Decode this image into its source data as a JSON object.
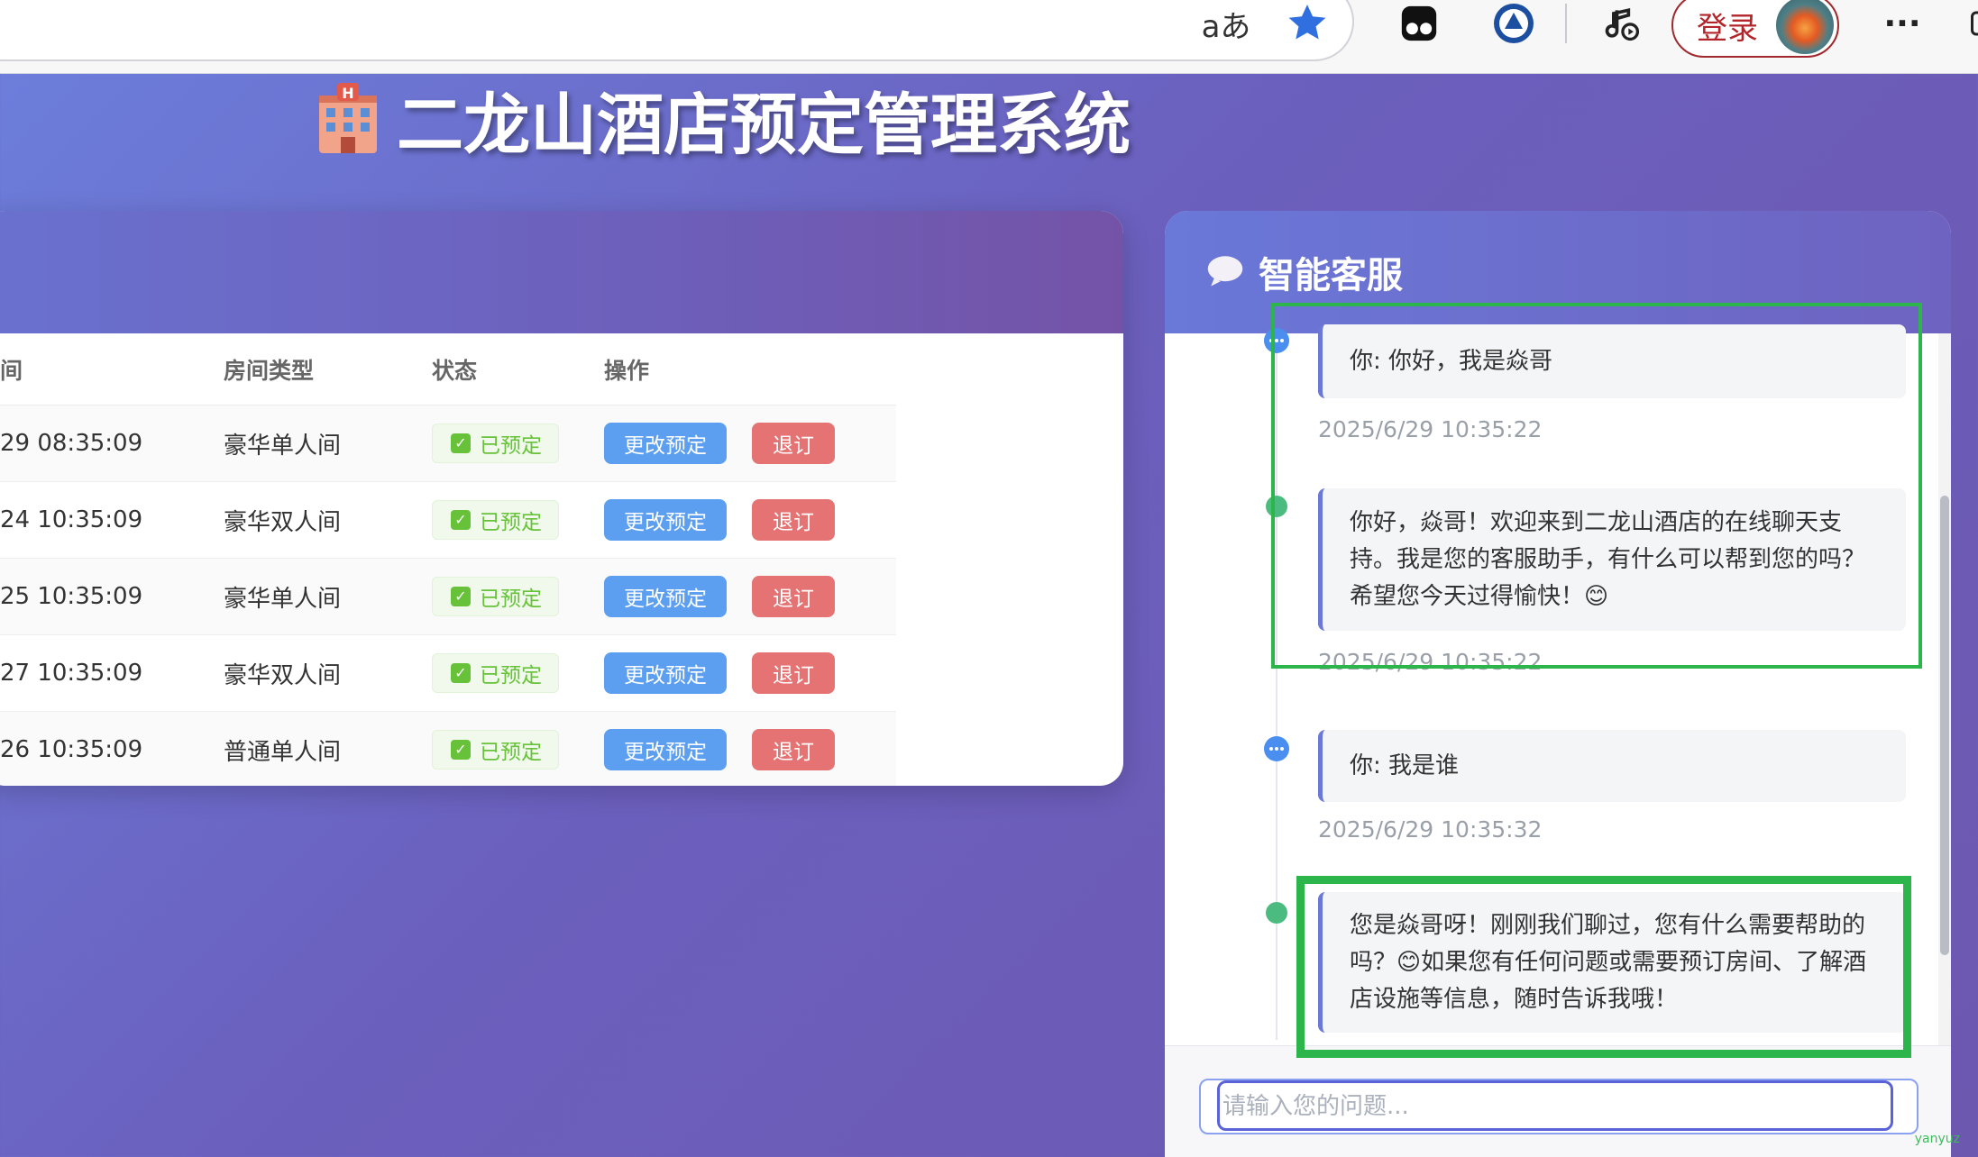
{
  "browser": {
    "login_label": "登录",
    "read_aloud_glyph": "aあ",
    "more_glyph": "···"
  },
  "page": {
    "title": "二龙山酒店预定管理系统"
  },
  "bookings": {
    "headers": {
      "time": "间",
      "room_type": "房间类型",
      "status": "状态",
      "actions": "操作"
    },
    "rows": [
      {
        "time": "29 08:35:09",
        "room_type": "豪华单人间",
        "status": "已预定",
        "modify": "更改预定",
        "cancel": "退订"
      },
      {
        "time": "24 10:35:09",
        "room_type": "豪华双人间",
        "status": "已预定",
        "modify": "更改预定",
        "cancel": "退订"
      },
      {
        "time": "25 10:35:09",
        "room_type": "豪华单人间",
        "status": "已预定",
        "modify": "更改预定",
        "cancel": "退订"
      },
      {
        "time": "27 10:35:09",
        "room_type": "豪华双人间",
        "status": "已预定",
        "modify": "更改预定",
        "cancel": "退订"
      },
      {
        "time": "26 10:35:09",
        "room_type": "普通单人间",
        "status": "已预定",
        "modify": "更改预定",
        "cancel": "退订"
      }
    ]
  },
  "chat": {
    "title": "智能客服",
    "messages": [
      {
        "role": "user",
        "text": "你: 你好，我是焱哥",
        "time": "2025/6/29 10:35:22"
      },
      {
        "role": "bot",
        "text": "你好，焱哥！欢迎来到二龙山酒店的在线聊天支持。我是您的客服助手，有什么可以帮到您的吗？希望您今天过得愉快！😊",
        "time": "2025/6/29 10:35:22"
      },
      {
        "role": "user",
        "text": "你: 我是谁",
        "time": "2025/6/29 10:35:32"
      },
      {
        "role": "bot",
        "text": "您是焱哥呀！刚刚我们聊过，您有什么需要帮助的吗？😊如果您有任何问题或需要预订房间、了解酒店设施等信息，随时告诉我哦！",
        "time": ""
      }
    ],
    "input_placeholder": "请输入您的问题..."
  },
  "watermark": "yanyuz",
  "colors": {
    "accent": "#6b78d5",
    "status_green": "#67c23a",
    "modify_blue": "#5c9ff0",
    "cancel_red": "#e57373",
    "highlight_green": "#2bb54b"
  }
}
